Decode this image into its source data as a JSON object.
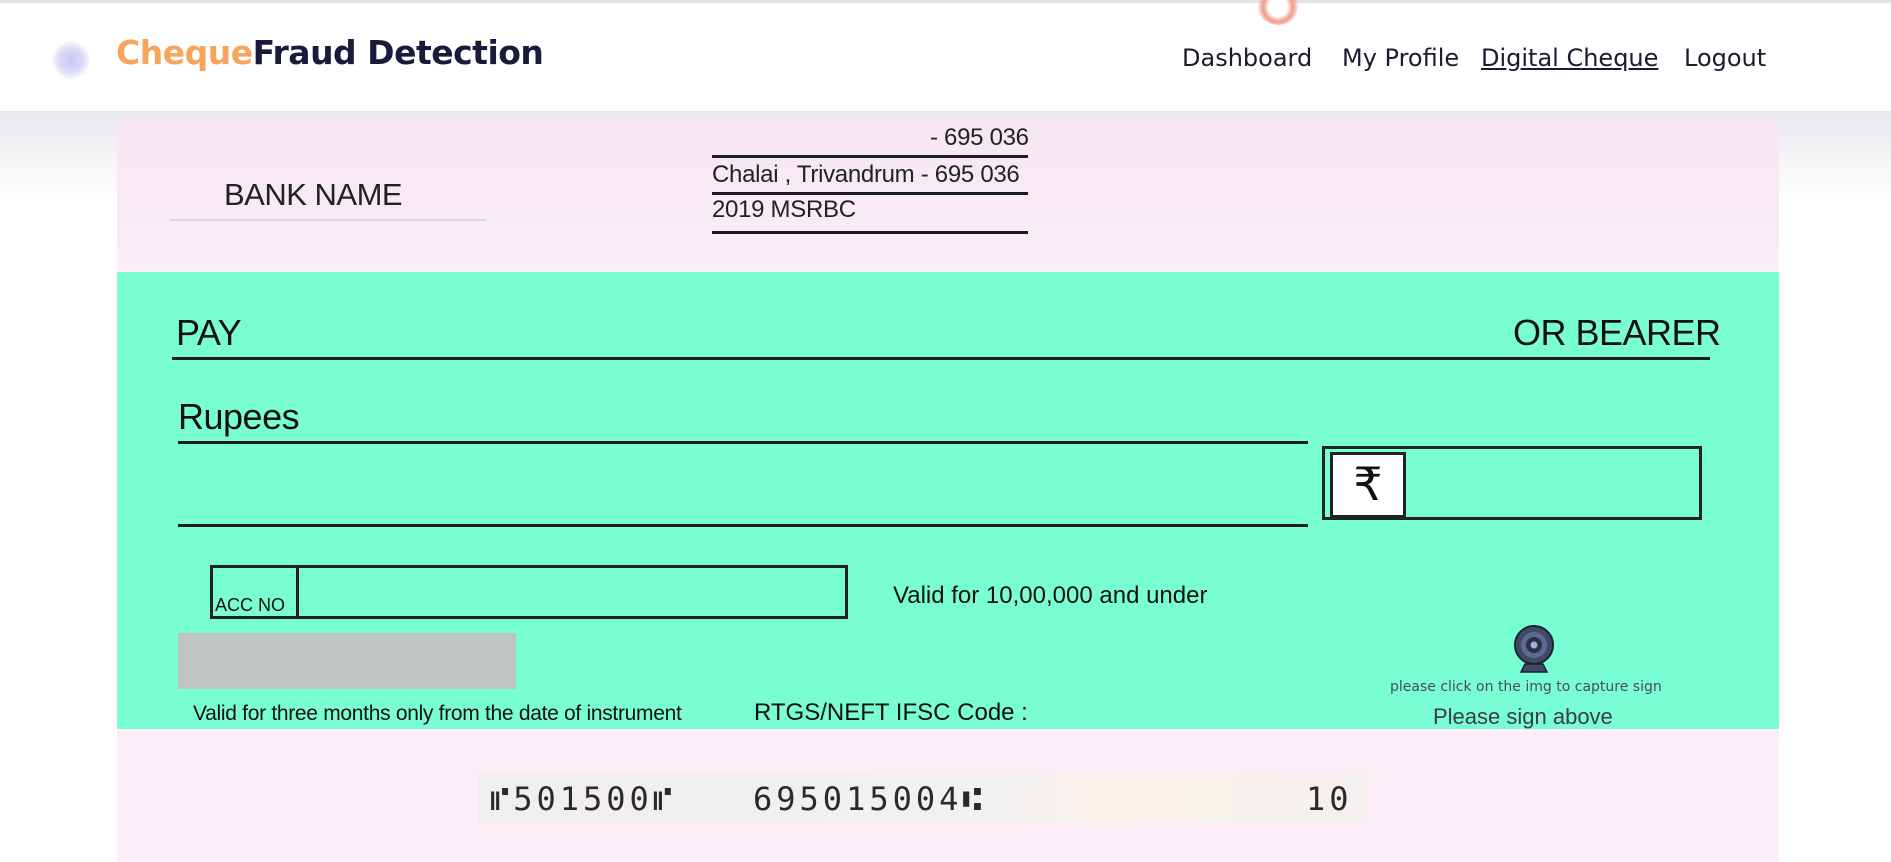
{
  "app": {
    "brand_part1": "Cheque",
    "brand_part2": "Fraud Detection",
    "accent_color": "#f6a55a",
    "brand_dark_color": "#1a1a3a"
  },
  "nav": {
    "items": [
      {
        "label": "Dashboard",
        "active": false
      },
      {
        "label": "My Profile",
        "active": false
      },
      {
        "label": "Digital Cheque",
        "active": true
      },
      {
        "label": "Logout",
        "active": false
      }
    ]
  },
  "cheque": {
    "bank_name": "BANK NAME",
    "address_line1": "- 695 036",
    "address_line2": "Chalai , Trivandrum  -  695 036",
    "address_line3": "2019 MSRBC",
    "pay_label": "PAY",
    "bearer_label": "OR BEARER",
    "rupees_label": "Rupees",
    "rupee_symbol": "₹",
    "acc_no_label": "ACC NO",
    "valid_amount": "Valid for 10,00,000 and under",
    "validity_note": "Valid for three months only from the date of instrument",
    "ifsc_label": "RTGS/NEFT  IFSC  Code :",
    "capture_hint": "please click on the img to capture sign",
    "sign_above": "Please sign above",
    "camera_icon": "webcam-icon",
    "green_color": "#79fed4",
    "pink_color": "#fbeef7",
    "micr_part1": "⑈501500⑈",
    "micr_part2": "695015004⑆",
    "micr_part3": "10"
  }
}
